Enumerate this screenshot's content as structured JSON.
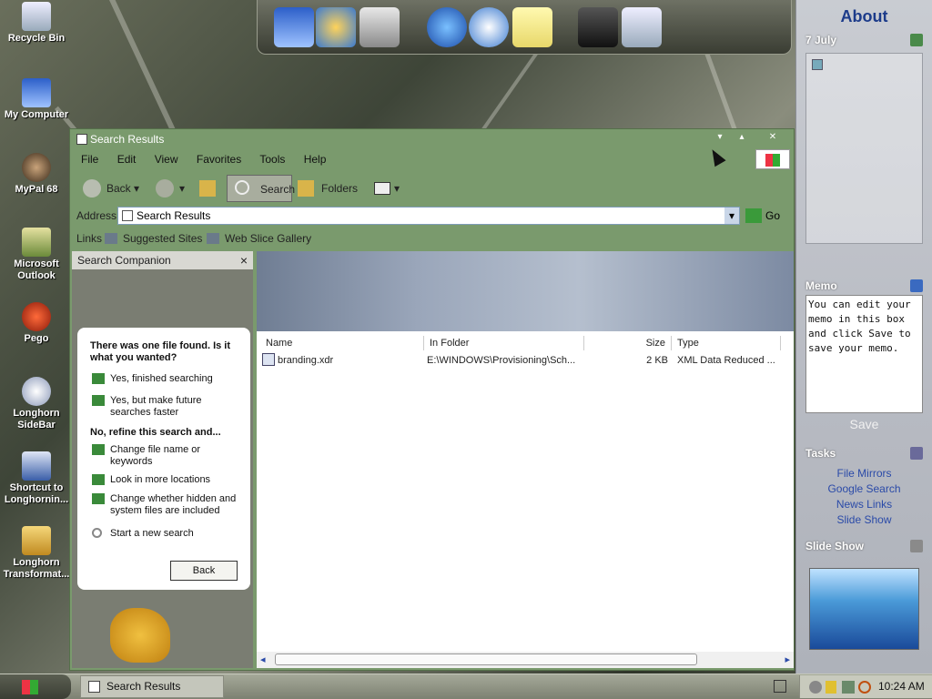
{
  "desktop_icons": [
    {
      "label": "Recycle Bin",
      "icon": "recycle-bin-icon"
    },
    {
      "label": "My Computer",
      "icon": "computer-icon"
    },
    {
      "label": "MyPal 68",
      "icon": "raccoon-icon"
    },
    {
      "label": "Microsoft Outlook",
      "icon": "outlook-icon"
    },
    {
      "label": "Pego",
      "icon": "red-orb-icon"
    },
    {
      "label": "Longhorn SideBar",
      "icon": "sidebar-icon"
    },
    {
      "label": "Shortcut to Longhornin...",
      "icon": "monitor-info-icon"
    },
    {
      "label": "Longhorn Transformat...",
      "icon": "folder-icon"
    }
  ],
  "window": {
    "title": "Search Results",
    "menu": [
      "File",
      "Edit",
      "View",
      "Favorites",
      "Tools",
      "Help"
    ],
    "toolbar": {
      "back": "Back",
      "search": "Search",
      "folders": "Folders"
    },
    "address": {
      "label": "Address",
      "value": "Search Results",
      "go": "Go"
    },
    "links": {
      "label": "Links",
      "items": [
        "Suggested Sites",
        "Web Slice Gallery"
      ]
    }
  },
  "companion": {
    "title": "Search Companion",
    "close": "×",
    "question": "There was one file found.  Is it what you wanted?",
    "yes_options": [
      "Yes, finished searching",
      "Yes, but make future searches faster"
    ],
    "refine_heading": "No, refine this search and...",
    "refine_options": [
      "Change file name or keywords",
      "Look in more locations",
      "Change whether hidden and system files are included"
    ],
    "new_search": "Start a new search",
    "back": "Back"
  },
  "results": {
    "columns": [
      "Name",
      "In Folder",
      "Size",
      "Type"
    ],
    "rows": [
      {
        "name": "branding.xdr",
        "folder": "E:\\WINDOWS\\Provisioning\\Sch...",
        "size": "2 KB",
        "type": "XML Data Reduced ..."
      }
    ]
  },
  "sidebar": {
    "about": "About",
    "date": "7 July",
    "memo_title": "Memo",
    "memo_text": "You can edit your memo in this box and click Save to save your memo.",
    "save": "Save",
    "tasks_title": "Tasks",
    "tasks": [
      "File Mirrors",
      "Google Search",
      "News Links",
      "Slide Show"
    ],
    "slideshow_title": "Slide Show"
  },
  "taskbar": {
    "task": "Search Results",
    "clock": "10:24 AM"
  }
}
